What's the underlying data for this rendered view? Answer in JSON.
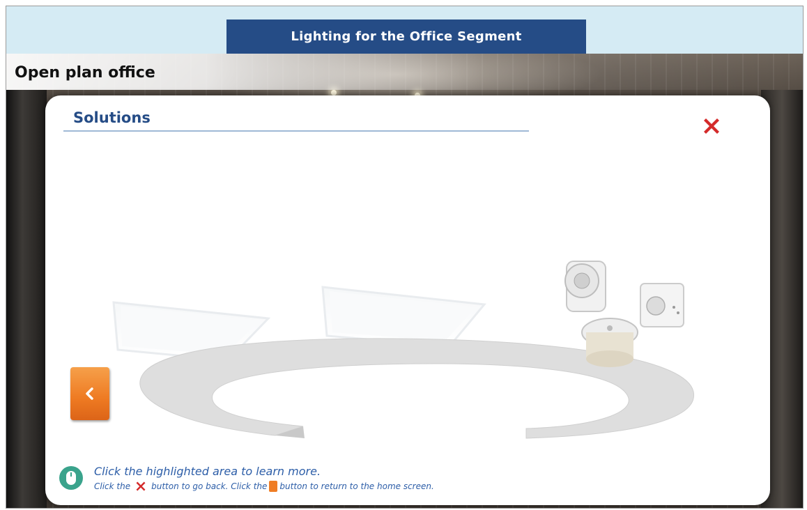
{
  "header": {
    "title": "Lighting for the Office Segment"
  },
  "section": {
    "title": "Open plan office"
  },
  "panel": {
    "title": "Solutions",
    "close_icon": "close-x-icon",
    "back_icon": "chevron-left-icon"
  },
  "hint": {
    "line1": "Click the highlighted area to learn more.",
    "line2_part1": "Click the",
    "line2_part2": "button to go back. Click the",
    "line2_part3": "button to return to the home screen."
  },
  "colors": {
    "header_bg": "#d5ebf4",
    "title_tab": "#254c86",
    "accent_orange": "#ef7d25",
    "close_red": "#d42a2a",
    "hint_text": "#2d5ea8",
    "mouse_icon": "#3aa38c"
  }
}
